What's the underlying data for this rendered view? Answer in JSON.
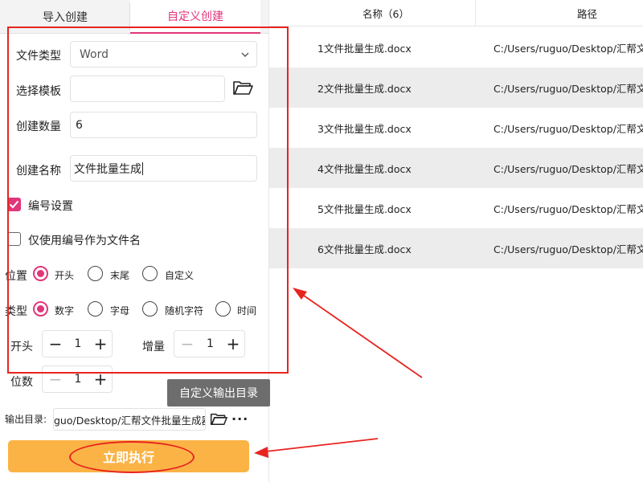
{
  "tabs": {
    "import": "导入创建",
    "custom": "自定义创建"
  },
  "form": {
    "file_type_label": "文件类型",
    "file_type_value": "Word",
    "template_label": "选择模板",
    "template_value": "",
    "count_label": "创建数量",
    "count_value": "6",
    "name_label": "创建名称",
    "name_value": "文件批量生成",
    "numbering_label": "编号设置",
    "numbering_checked": true,
    "only_number_label": "仅使用编号作为文件名",
    "only_number_checked": false,
    "position_label": "位置",
    "position_options": [
      "开头",
      "末尾",
      "自定义"
    ],
    "position_selected": "开头",
    "type_label": "类型",
    "type_options": [
      "数字",
      "字母",
      "随机字符",
      "时间"
    ],
    "type_selected": "数字",
    "start_label": "开头",
    "start_value": "1",
    "increment_label": "增量",
    "increment_value": "1",
    "digits_label": "位数",
    "digits_value": "1"
  },
  "tooltip": "自定义输出目录",
  "output": {
    "label": "输出目录:",
    "path": "guo/Desktop/汇帮文件批量生成器",
    "more": "···"
  },
  "run_button": "立即执行",
  "table": {
    "name_header": "名称（6）",
    "path_header": "路径",
    "rows": [
      {
        "name": "1文件批量生成.docx",
        "path": "C:/Users/ruguo/Desktop/汇帮文件"
      },
      {
        "name": "2文件批量生成.docx",
        "path": "C:/Users/ruguo/Desktop/汇帮文件"
      },
      {
        "name": "3文件批量生成.docx",
        "path": "C:/Users/ruguo/Desktop/汇帮文件"
      },
      {
        "name": "4文件批量生成.docx",
        "path": "C:/Users/ruguo/Desktop/汇帮文件"
      },
      {
        "name": "5文件批量生成.docx",
        "path": "C:/Users/ruguo/Desktop/汇帮文件"
      },
      {
        "name": "6文件批量生成.docx",
        "path": "C:/Users/ruguo/Desktop/汇帮文件"
      }
    ]
  },
  "colors": {
    "accent": "#e0367a",
    "run_button": "#fbb346",
    "annotation": "#e8241f"
  }
}
